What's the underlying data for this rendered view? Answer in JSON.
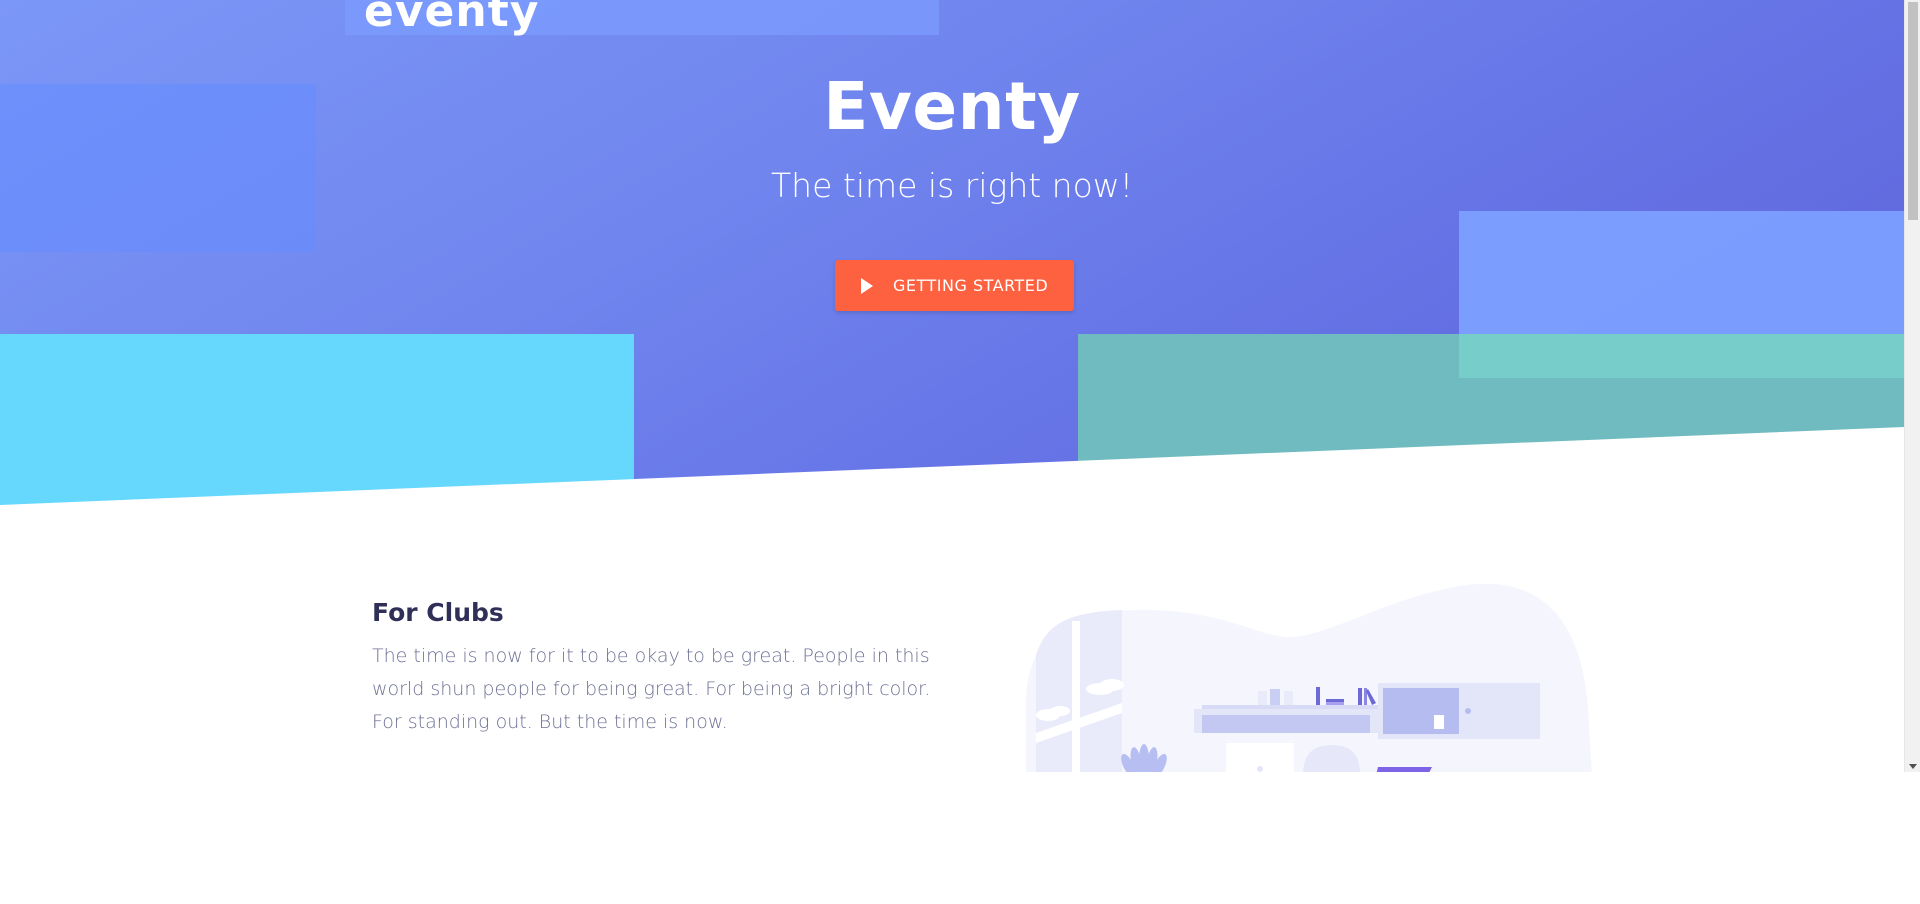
{
  "brand": {
    "logo_text": "eventy"
  },
  "hero": {
    "title": "Eventy",
    "subtitle": "The time is right now!",
    "cta_label": "GETTING STARTED"
  },
  "section": {
    "title": "For Clubs",
    "body": "The time is now for it to be okay to be great. People in this world shun people for being great. For being a bright color. For standing out. But the time is now."
  },
  "colors": {
    "hero_gradient_start": "#7b97f7",
    "hero_gradient_end": "#5d62d6",
    "cta": "#fe6140",
    "cyan": "#67d8fd",
    "teal": "#70bbbf",
    "heading": "#2f2f58",
    "body_text": "#6e7195"
  },
  "icons": {
    "cta_icon": "play-icon",
    "scroll_down": "chevron-down-icon"
  }
}
